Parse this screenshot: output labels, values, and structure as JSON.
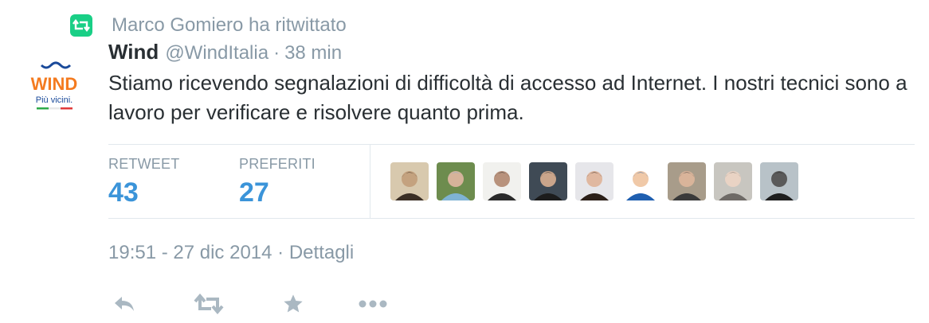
{
  "context": {
    "retweeted_by": "Marco Gomiero ha ritwittato"
  },
  "author": {
    "name": "Wind",
    "handle": "@WindItalia",
    "age": "38 min",
    "logo_text": "WIND",
    "logo_tagline": "Più vicini."
  },
  "tweet": {
    "text": "Stiamo ricevendo segnalazioni di difficoltà di accesso ad Internet. I nostri tecnici sono a lavoro per verificare e risolvere quanto prima."
  },
  "stats": {
    "retweet_label": "RETWEET",
    "retweet_count": "43",
    "fav_label": "PREFERITI",
    "fav_count": "27"
  },
  "favoriters_count": 9,
  "timestamp": {
    "time_date": "19:51 - 27 dic 2014",
    "details": "Dettagli"
  },
  "icons": [
    "retweet-icon",
    "reply-icon",
    "retweet-icon",
    "favorite-icon",
    "more-icon"
  ],
  "colors": {
    "retweet_green": "#19cf86",
    "link_blue": "#3b94d9",
    "muted": "#8899a6",
    "text": "#292f33",
    "divider": "#e1e8ed",
    "action_icon": "#aab8c2",
    "wind_orange": "#f47b20",
    "wind_blue": "#1a4a9a"
  }
}
